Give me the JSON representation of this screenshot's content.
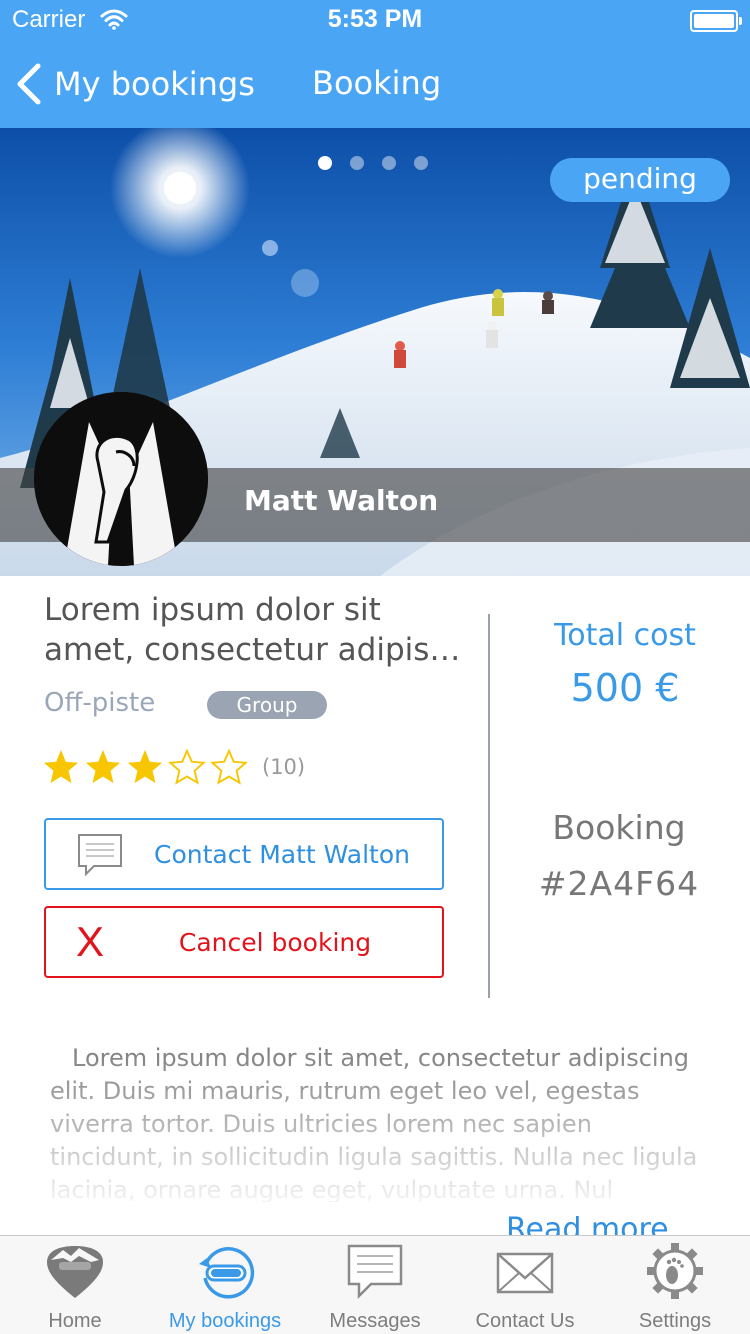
{
  "status_bar": {
    "carrier": "Carrier",
    "time": "5:53 PM"
  },
  "nav": {
    "back_label": "My bookings",
    "title": "Booking"
  },
  "hero": {
    "status_badge": "pending",
    "host_name": "Matt Walton",
    "pager": {
      "total": 4,
      "active": 1
    }
  },
  "listing": {
    "title_line1": "Lorem ipsum dolor sit",
    "title_line2": "amet, consectetur adipiscing elit",
    "category": "Off-piste",
    "tag": "Group",
    "rating": 3,
    "rating_max": 5,
    "rating_count": "(10)"
  },
  "actions": {
    "contact_label": "Contact Matt Walton",
    "cancel_icon": "X",
    "cancel_label": "Cancel booking"
  },
  "summary": {
    "total_cost_label": "Total cost",
    "total_cost_value": "500 €",
    "booking_label": "Booking",
    "booking_id": "#2A4F64"
  },
  "description": {
    "text": "Lorem ipsum dolor sit amet, consectetur adipiscing elit. Duis mi mauris, rutrum eget leo vel, egestas viverra tortor. Duis ultricies lorem nec sapien tincidunt, in sollicitudin ligula sagittis. Nulla nec ligula lacinia, ornare augue eget, vulputate urna. Nul",
    "read_more": "Read more"
  },
  "tabs": [
    {
      "label": "Home",
      "icon": "mountain-pin-icon"
    },
    {
      "label": "My bookings",
      "icon": "ski-goggles-icon",
      "active": true
    },
    {
      "label": "Messages",
      "icon": "message-bubble-icon"
    },
    {
      "label": "Contact Us",
      "icon": "envelope-icon"
    },
    {
      "label": "Settings",
      "icon": "gear-icon"
    }
  ],
  "colors": {
    "brand_blue": "#4aa6f4",
    "accent_text_blue": "#2f8fe0",
    "danger_red": "#e3131b",
    "star_yellow": "#f7c600"
  }
}
